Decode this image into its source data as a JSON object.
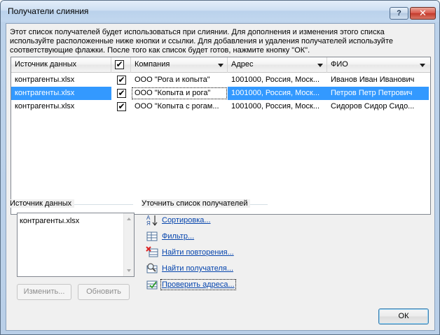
{
  "window": {
    "title": "Получатели слияния",
    "help_label": "?",
    "close_label": "✕"
  },
  "description": "Этот список получателей будет использоваться при слиянии. Для дополнения и изменения этого списка используйте расположенные ниже кнопки и ссылки. Для добавления и удаления получателей используйте соответствующие флажки. После того как список будет готов, нажмите кнопку \"ОК\".",
  "grid": {
    "columns": {
      "source": "Источник данных",
      "check": "✔",
      "company": "Компания",
      "address": "Адрес",
      "fio": "ФИО"
    },
    "rows": [
      {
        "source": "контрагенты.xlsx",
        "checked": "✔",
        "company": "ООО \"Рога и копыта\"",
        "address": "1001000, Россия, Моск...",
        "fio": "Иванов Иван Иванович"
      },
      {
        "source": "контрагенты.xlsx",
        "checked": "✔",
        "company": "ООО \"Копыта и рога\"",
        "address": "1001000, Россия, Моск...",
        "fio": "Петров Петр Петрович"
      },
      {
        "source": "контрагенты.xlsx",
        "checked": "✔",
        "company": "ООО \"Копыта с рогам...",
        "address": "1001000, Россия, Моск...",
        "fio": "Сидоров Сидор Сидо..."
      }
    ]
  },
  "data_source": {
    "label": "Источник данных",
    "items": [
      "контрагенты.xlsx"
    ],
    "edit_button": "Изменить...",
    "refresh_button": "Обновить"
  },
  "refine": {
    "label": "Уточнить список получателей",
    "links": {
      "sort": "Сортировка...",
      "filter": "Фильтр...",
      "duplicates": "Найти повторения...",
      "find": "Найти получателя...",
      "validate": "Проверить адреса..."
    }
  },
  "ok_button": "ОК"
}
